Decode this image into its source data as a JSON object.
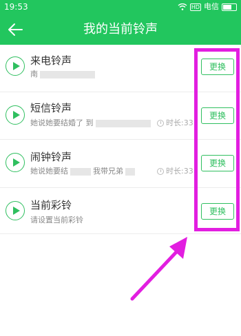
{
  "status": {
    "time": "19:53",
    "sim": "HD",
    "carrier": "电信",
    "battery_level": 0.75
  },
  "header": {
    "title": "我的当前铃声"
  },
  "rows": [
    {
      "title": "来电铃声",
      "sub": "南",
      "duration": "",
      "button": "更换"
    },
    {
      "title": "短信铃声",
      "sub": "她说她要结婚了 到",
      "duration": "时长:33",
      "button": "更换"
    },
    {
      "title": "闹钟铃声",
      "sub": "她说她要结",
      "sub2": "我带兄弟",
      "duration": "时长:33",
      "button": "更换"
    },
    {
      "title": "当前彩铃",
      "sub": "请设置当前彩铃",
      "duration": "",
      "button": "更换"
    }
  ],
  "colors": {
    "brand_green": "#22c65e",
    "accent_green": "#2fbf5f",
    "annotation_magenta": "#e21ee0"
  }
}
